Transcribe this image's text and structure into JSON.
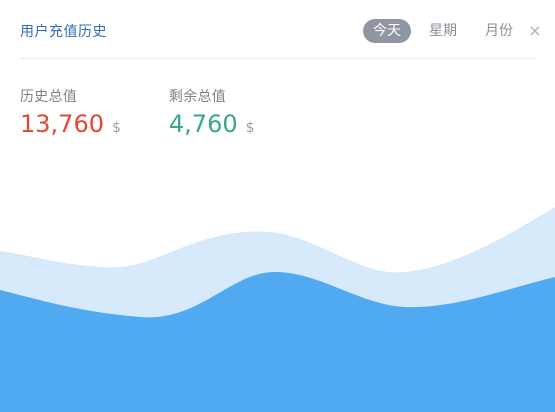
{
  "header": {
    "title": "用户充值历史",
    "tabs": [
      {
        "label": "今天",
        "active": true
      },
      {
        "label": "星期",
        "active": false
      },
      {
        "label": "月份",
        "active": false
      }
    ],
    "close_label": "×"
  },
  "stats": {
    "history_total": {
      "label": "历史总值",
      "value": "13,760",
      "currency": "$",
      "color": "#e0483a"
    },
    "remaining_total": {
      "label": "剩余总值",
      "value": "4,760",
      "currency": "$",
      "color": "#3aa68f"
    }
  },
  "chart_data": {
    "type": "area",
    "series": [
      {
        "color": "#d6eafc"
      },
      {
        "color": "#4faaf2"
      }
    ]
  }
}
